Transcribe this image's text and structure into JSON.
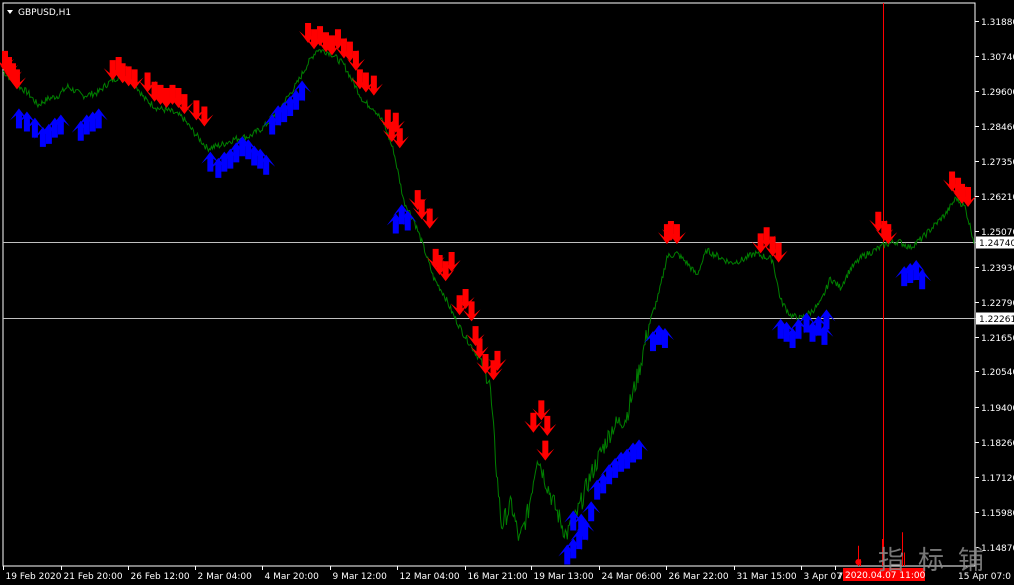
{
  "window": {
    "title": "GBPUSD,H1"
  },
  "colors": {
    "background": "#000000",
    "frame": "#ffffff",
    "price_line": "#008000",
    "sell_arrow": "#ff0000",
    "buy_arrow": "#0000ff",
    "hline": "#c0c0c0",
    "vline": "#ff0000",
    "label_bg": "#ffffff",
    "label_fg": "#000000",
    "date_label_bg": "#ff0000"
  },
  "watermark": {
    "text": "指标铺"
  },
  "chart_data": {
    "type": "line",
    "symbol": "GBPUSD",
    "timeframe": "H1",
    "ylim": [
      1.1425,
      1.3245
    ],
    "yticks": [
      "1.31880",
      "1.30740",
      "1.29600",
      "1.28460",
      "1.27350",
      "1.26210",
      "1.25070",
      "1.23930",
      "1.22790",
      "1.21650",
      "1.20540",
      "1.19400",
      "1.18260",
      "1.17120",
      "1.15980",
      "1.14870"
    ],
    "xticks": [
      "19 Feb 2020",
      "21 Feb 20:00",
      "26 Feb 12:00",
      "2 Mar 04:00",
      "4 Mar 20:00",
      "9 Mar 12:00",
      "12 Mar 04:00",
      "16 Mar 21:00",
      "19 Mar 13:00",
      "24 Mar 06:00",
      "26 Mar 22:00",
      "31 Mar 15:00",
      "3 Apr 07:00",
      "7"
    ],
    "xtick_tail": "15 Apr 07:0",
    "xtick_index": [
      0,
      58,
      125,
      193,
      260,
      328,
      395,
      463,
      530,
      598,
      665,
      733,
      800,
      835
    ],
    "x_count": 975,
    "anchors": [
      [
        0,
        1.3025
      ],
      [
        12,
        1.2985
      ],
      [
        25,
        1.2955
      ],
      [
        35,
        1.2915
      ],
      [
        45,
        1.2935
      ],
      [
        55,
        1.2945
      ],
      [
        65,
        1.2975
      ],
      [
        80,
        1.2945
      ],
      [
        95,
        1.2955
      ],
      [
        105,
        1.2985
      ],
      [
        115,
        1.3005
      ],
      [
        130,
        1.2995
      ],
      [
        142,
        1.2935
      ],
      [
        155,
        1.2905
      ],
      [
        168,
        1.2895
      ],
      [
        180,
        1.2875
      ],
      [
        192,
        1.2825
      ],
      [
        205,
        1.2775
      ],
      [
        218,
        1.2785
      ],
      [
        232,
        1.2805
      ],
      [
        248,
        1.2815
      ],
      [
        262,
        1.2845
      ],
      [
        278,
        1.2905
      ],
      [
        295,
        1.2985
      ],
      [
        305,
        1.3045
      ],
      [
        315,
        1.3095
      ],
      [
        328,
        1.3085
      ],
      [
        342,
        1.3045
      ],
      [
        352,
        1.2985
      ],
      [
        362,
        1.2925
      ],
      [
        372,
        1.2905
      ],
      [
        382,
        1.2855
      ],
      [
        392,
        1.2765
      ],
      [
        402,
        1.2605
      ],
      [
        412,
        1.2545
      ],
      [
        422,
        1.2455
      ],
      [
        432,
        1.2355
      ],
      [
        442,
        1.2305
      ],
      [
        452,
        1.2235
      ],
      [
        462,
        1.2175
      ],
      [
        472,
        1.2125
      ],
      [
        480,
        1.2085
      ],
      [
        488,
        1.2025
      ],
      [
        495,
        1.1735
      ],
      [
        500,
        1.1555
      ],
      [
        510,
        1.1625
      ],
      [
        518,
        1.1505
      ],
      [
        527,
        1.1605
      ],
      [
        536,
        1.1785
      ],
      [
        545,
        1.1695
      ],
      [
        555,
        1.1605
      ],
      [
        565,
        1.1525
      ],
      [
        575,
        1.1585
      ],
      [
        588,
        1.1705
      ],
      [
        600,
        1.1795
      ],
      [
        612,
        1.1875
      ],
      [
        625,
        1.1905
      ],
      [
        638,
        1.2055
      ],
      [
        648,
        1.2205
      ],
      [
        658,
        1.2305
      ],
      [
        666,
        1.2425
      ],
      [
        676,
        1.2435
      ],
      [
        686,
        1.2405
      ],
      [
        696,
        1.2365
      ],
      [
        706,
        1.2445
      ],
      [
        718,
        1.2425
      ],
      [
        730,
        1.2405
      ],
      [
        742,
        1.2415
      ],
      [
        754,
        1.2435
      ],
      [
        764,
        1.2425
      ],
      [
        772,
        1.2415
      ],
      [
        780,
        1.2285
      ],
      [
        790,
        1.2235
      ],
      [
        800,
        1.2225
      ],
      [
        810,
        1.2245
      ],
      [
        820,
        1.2275
      ],
      [
        830,
        1.2355
      ],
      [
        840,
        1.2325
      ],
      [
        850,
        1.2385
      ],
      [
        862,
        1.2425
      ],
      [
        874,
        1.2445
      ],
      [
        886,
        1.2465
      ],
      [
        898,
        1.2475
      ],
      [
        910,
        1.2455
      ],
      [
        922,
        1.2485
      ],
      [
        934,
        1.2525
      ],
      [
        946,
        1.2565
      ],
      [
        956,
        1.2615
      ],
      [
        965,
        1.2585
      ],
      [
        970,
        1.2525
      ],
      [
        974,
        1.2475
      ]
    ],
    "sell_arrows": [
      [
        2,
        1.3045
      ],
      [
        6,
        1.3025
      ],
      [
        10,
        1.3005
      ],
      [
        14,
        1.2985
      ],
      [
        110,
        1.3015
      ],
      [
        116,
        1.3025
      ],
      [
        120,
        1.3005
      ],
      [
        126,
        1.2995
      ],
      [
        132,
        1.2985
      ],
      [
        145,
        1.2975
      ],
      [
        152,
        1.2945
      ],
      [
        158,
        1.2935
      ],
      [
        164,
        1.2925
      ],
      [
        170,
        1.2935
      ],
      [
        176,
        1.2925
      ],
      [
        182,
        1.2905
      ],
      [
        194,
        1.2885
      ],
      [
        202,
        1.2865
      ],
      [
        306,
        1.3135
      ],
      [
        312,
        1.3115
      ],
      [
        318,
        1.3125
      ],
      [
        324,
        1.3105
      ],
      [
        330,
        1.3095
      ],
      [
        336,
        1.3115
      ],
      [
        342,
        1.3085
      ],
      [
        348,
        1.3075
      ],
      [
        354,
        1.3045
      ],
      [
        358,
        1.2985
      ],
      [
        364,
        1.2975
      ],
      [
        372,
        1.2965
      ],
      [
        386,
        1.2855
      ],
      [
        390,
        1.2815
      ],
      [
        394,
        1.2845
      ],
      [
        398,
        1.2795
      ],
      [
        416,
        1.2595
      ],
      [
        420,
        1.2565
      ],
      [
        428,
        1.2535
      ],
      [
        434,
        1.2405
      ],
      [
        438,
        1.2385
      ],
      [
        444,
        1.2365
      ],
      [
        450,
        1.2395
      ],
      [
        458,
        1.2255
      ],
      [
        464,
        1.2275
      ],
      [
        470,
        1.2235
      ],
      [
        474,
        1.2155
      ],
      [
        478,
        1.2115
      ],
      [
        484,
        1.2065
      ],
      [
        492,
        1.2045
      ],
      [
        496,
        1.2075
      ],
      [
        532,
        1.1875
      ],
      [
        540,
        1.1915
      ],
      [
        546,
        1.1865
      ],
      [
        544,
        1.1785
      ],
      [
        666,
        1.2485
      ],
      [
        670,
        1.2495
      ],
      [
        676,
        1.2485
      ],
      [
        760,
        1.2455
      ],
      [
        766,
        1.2475
      ],
      [
        772,
        1.2445
      ],
      [
        778,
        1.2425
      ],
      [
        878,
        1.2525
      ],
      [
        884,
        1.2495
      ],
      [
        888,
        1.2485
      ],
      [
        952,
        1.2655
      ],
      [
        958,
        1.2635
      ],
      [
        962,
        1.2615
      ],
      [
        968,
        1.2605
      ]
    ],
    "buy_arrows": [
      [
        16,
        1.2885
      ],
      [
        24,
        1.2875
      ],
      [
        32,
        1.2855
      ],
      [
        40,
        1.2825
      ],
      [
        46,
        1.2835
      ],
      [
        52,
        1.2855
      ],
      [
        58,
        1.2865
      ],
      [
        78,
        1.2845
      ],
      [
        84,
        1.2865
      ],
      [
        90,
        1.2875
      ],
      [
        96,
        1.2885
      ],
      [
        208,
        1.2745
      ],
      [
        216,
        1.2725
      ],
      [
        222,
        1.2745
      ],
      [
        228,
        1.2755
      ],
      [
        234,
        1.2775
      ],
      [
        240,
        1.2795
      ],
      [
        246,
        1.2785
      ],
      [
        252,
        1.2765
      ],
      [
        258,
        1.2755
      ],
      [
        264,
        1.2735
      ],
      [
        270,
        1.2865
      ],
      [
        276,
        1.2895
      ],
      [
        282,
        1.2905
      ],
      [
        288,
        1.2925
      ],
      [
        294,
        1.2945
      ],
      [
        300,
        1.2975
      ],
      [
        394,
        1.2545
      ],
      [
        400,
        1.2575
      ],
      [
        406,
        1.2555
      ],
      [
        652,
        1.2165
      ],
      [
        658,
        1.2185
      ],
      [
        664,
        1.2175
      ],
      [
        566,
        1.1475
      ],
      [
        572,
        1.1495
      ],
      [
        578,
        1.1525
      ],
      [
        584,
        1.1555
      ],
      [
        572,
        1.1585
      ],
      [
        580,
        1.1575
      ],
      [
        590,
        1.1615
      ],
      [
        596,
        1.1685
      ],
      [
        602,
        1.1705
      ],
      [
        608,
        1.1735
      ],
      [
        614,
        1.1755
      ],
      [
        620,
        1.1775
      ],
      [
        626,
        1.1785
      ],
      [
        632,
        1.1805
      ],
      [
        638,
        1.1815
      ],
      [
        780,
        1.2205
      ],
      [
        786,
        1.2195
      ],
      [
        792,
        1.2175
      ],
      [
        798,
        1.2205
      ],
      [
        806,
        1.2225
      ],
      [
        812,
        1.2195
      ],
      [
        818,
        1.2215
      ],
      [
        824,
        1.2185
      ],
      [
        826,
        1.2235
      ],
      [
        904,
        1.2375
      ],
      [
        910,
        1.2385
      ],
      [
        916,
        1.2395
      ],
      [
        922,
        1.2365
      ]
    ],
    "hlines": [
      {
        "price": 1.2474,
        "label": "1.24740"
      },
      {
        "price": 1.22261,
        "label": "1.22261"
      }
    ],
    "vline_index": 883,
    "vline_label": "2020.04.07 11:00",
    "bottom_spikes": [
      [
        858,
        0.018
      ],
      [
        860,
        0.006
      ],
      [
        882,
        0.024
      ],
      [
        902,
        0.03
      ],
      [
        904,
        0.012
      ]
    ]
  }
}
